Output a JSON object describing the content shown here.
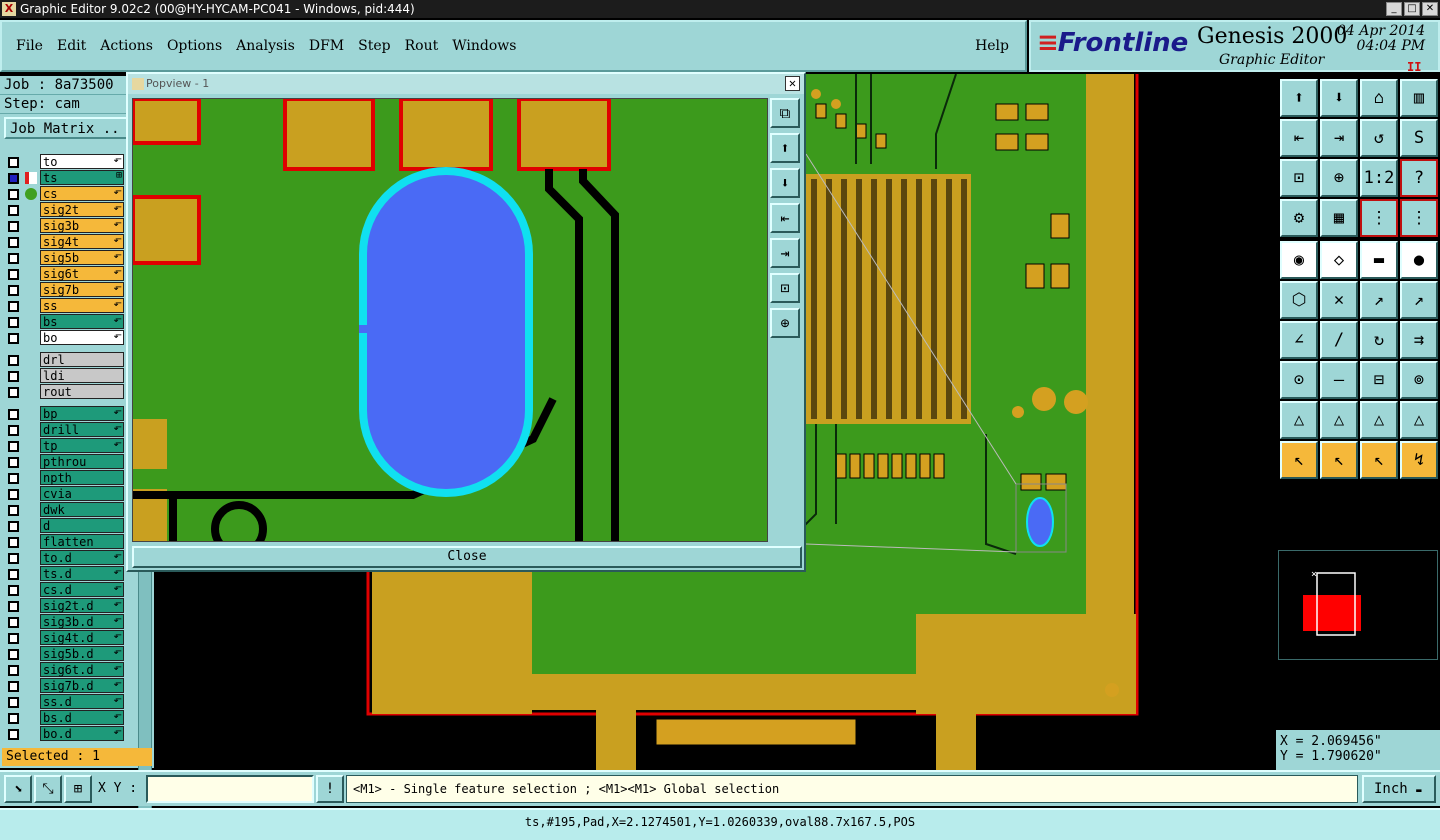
{
  "window": {
    "title": "Graphic Editor 9.02c2 (00@HY-HYCAM-PC041 - Windows, pid:444)",
    "min": "_",
    "max": "□",
    "close": "✕"
  },
  "menu": [
    "File",
    "Edit",
    "Actions",
    "Options",
    "Analysis",
    "DFM",
    "Step",
    "Rout",
    "Windows"
  ],
  "help": "Help",
  "logo": {
    "brand": "Frontline",
    "product": "Genesis 2000",
    "sub": "Graphic Editor",
    "date": "04 Apr 2014",
    "time": "04:04 PM",
    "pause": "II"
  },
  "job": "Job : 8a73500",
  "step": "Step: cam",
  "job_matrix": "Job Matrix ..",
  "colors": {
    "orange": "#f5b83a",
    "teal": "#1e9a7a",
    "white": "#ffffff",
    "grey": "#c8c8c8",
    "board_green": "#3c9a1c",
    "copper": "#c9a020",
    "pad_blue": "#4a6af5",
    "outline_cyan": "#10e0f0"
  },
  "layers": [
    {
      "name": "to",
      "color": "white",
      "arrow": "⬐",
      "marker": ""
    },
    {
      "name": "ts",
      "color": "teal",
      "arrow": "⊞",
      "marker": "edit",
      "checked": "blue"
    },
    {
      "name": "cs",
      "color": "orange",
      "arrow": "⬐",
      "marker": "green"
    },
    {
      "name": "sig2t",
      "color": "orange",
      "arrow": "⬐"
    },
    {
      "name": "sig3b",
      "color": "orange",
      "arrow": "⬐"
    },
    {
      "name": "sig4t",
      "color": "orange",
      "arrow": "⬐"
    },
    {
      "name": "sig5b",
      "color": "orange",
      "arrow": "⬐"
    },
    {
      "name": "sig6t",
      "color": "orange",
      "arrow": "⬐"
    },
    {
      "name": "sig7b",
      "color": "orange",
      "arrow": "⬐"
    },
    {
      "name": "ss",
      "color": "orange",
      "arrow": "⬐"
    },
    {
      "name": "bs",
      "color": "teal",
      "arrow": "⬐"
    },
    {
      "name": "bo",
      "color": "white",
      "arrow": "⬐"
    },
    {
      "sep": true
    },
    {
      "name": "drl",
      "color": "grey"
    },
    {
      "name": "ldi",
      "color": "grey"
    },
    {
      "name": "rout",
      "color": "grey"
    },
    {
      "sep": true
    },
    {
      "name": "bp",
      "color": "teal",
      "arrow": "⬐"
    },
    {
      "name": "drill",
      "color": "teal",
      "arrow": "⬐"
    },
    {
      "name": "tp",
      "color": "teal",
      "arrow": "⬐"
    },
    {
      "name": "pthrou",
      "color": "teal"
    },
    {
      "name": "npth",
      "color": "teal"
    },
    {
      "name": "cvia",
      "color": "teal"
    },
    {
      "name": "dwk",
      "color": "teal"
    },
    {
      "name": "d",
      "color": "teal"
    },
    {
      "name": "flatten",
      "color": "teal"
    },
    {
      "name": "to.d",
      "color": "teal",
      "arrow": "⬐"
    },
    {
      "name": "ts.d",
      "color": "teal",
      "arrow": "⬐"
    },
    {
      "name": "cs.d",
      "color": "teal",
      "arrow": "⬐"
    },
    {
      "name": "sig2t.d",
      "color": "teal",
      "arrow": "⬐"
    },
    {
      "name": "sig3b.d",
      "color": "teal",
      "arrow": "⬐"
    },
    {
      "name": "sig4t.d",
      "color": "teal",
      "arrow": "⬐"
    },
    {
      "name": "sig5b.d",
      "color": "teal",
      "arrow": "⬐"
    },
    {
      "name": "sig6t.d",
      "color": "teal",
      "arrow": "⬐"
    },
    {
      "name": "sig7b.d",
      "color": "teal",
      "arrow": "⬐"
    },
    {
      "name": "ss.d",
      "color": "teal",
      "arrow": "⬐"
    },
    {
      "name": "bs.d",
      "color": "teal",
      "arrow": "⬐"
    },
    {
      "name": "bo.d",
      "color": "teal",
      "arrow": "⬐"
    }
  ],
  "selected": "Selected : 1",
  "popview": {
    "title": "Popview - 1",
    "close_x": "✕",
    "close_button": "Close"
  },
  "coords": {
    "x": "X = 2.069456\"",
    "y": "Y = 1.790620\""
  },
  "xy_label": "X Y :",
  "xy_value": "",
  "bang": "!",
  "hint": "<M1> - Single feature selection ; <M1><M1> Global selection",
  "unit": "Inch",
  "unit_arrow": "▬",
  "status": "ts,#195,Pad,X=2.1274501,Y=1.0260339,oval88.7x167.5,POS",
  "tool_rows": [
    [
      {
        "i": "⬆",
        "t": "n"
      },
      {
        "i": "⬇",
        "t": "n"
      },
      {
        "i": "⌂",
        "t": "n"
      },
      {
        "i": "▥",
        "t": "n"
      }
    ],
    [
      {
        "i": "⇤",
        "t": "n"
      },
      {
        "i": "⇥",
        "t": "n"
      },
      {
        "i": "↺",
        "t": "n"
      },
      {
        "i": "S",
        "t": "n"
      }
    ],
    [
      {
        "i": "⊡",
        "t": "n"
      },
      {
        "i": "⊕",
        "t": "n"
      },
      {
        "i": "1:2",
        "t": "n"
      },
      {
        "i": "?",
        "t": "rd"
      }
    ],
    [
      {
        "i": "⚙",
        "t": "n"
      },
      {
        "i": "▦",
        "t": "n"
      },
      {
        "i": "⋮",
        "t": "rd"
      },
      {
        "i": "⋮",
        "t": "rd"
      }
    ],
    [
      {
        "i": "◉",
        "t": "w"
      },
      {
        "i": "◇",
        "t": "w"
      },
      {
        "i": "▬",
        "t": "w"
      },
      {
        "i": "●",
        "t": "w"
      }
    ],
    [
      {
        "i": "⬡",
        "t": "n"
      },
      {
        "i": "✕",
        "t": "n"
      },
      {
        "i": "↗",
        "t": "n"
      },
      {
        "i": "↗",
        "t": "n"
      }
    ],
    [
      {
        "i": "∠",
        "t": "n"
      },
      {
        "i": "/",
        "t": "n"
      },
      {
        "i": "↻",
        "t": "n"
      },
      {
        "i": "⇉",
        "t": "n"
      }
    ],
    [
      {
        "i": "⊙",
        "t": "n"
      },
      {
        "i": "—",
        "t": "n"
      },
      {
        "i": "⊟",
        "t": "n"
      },
      {
        "i": "⊚",
        "t": "n"
      }
    ],
    [
      {
        "i": "△",
        "t": "n"
      },
      {
        "i": "△",
        "t": "n"
      },
      {
        "i": "△",
        "t": "n"
      },
      {
        "i": "△",
        "t": "n"
      }
    ],
    [
      {
        "i": "↖",
        "t": "o"
      },
      {
        "i": "↖",
        "t": "o"
      },
      {
        "i": "↖",
        "t": "o"
      },
      {
        "i": "↯",
        "t": "o"
      }
    ]
  ],
  "popview_tools": [
    "⧉",
    "⬆",
    "⬇",
    "⇤",
    "⇥",
    "⊡",
    "⊕"
  ],
  "bottom_tools": [
    "⬊",
    "⤡",
    "⊞"
  ]
}
